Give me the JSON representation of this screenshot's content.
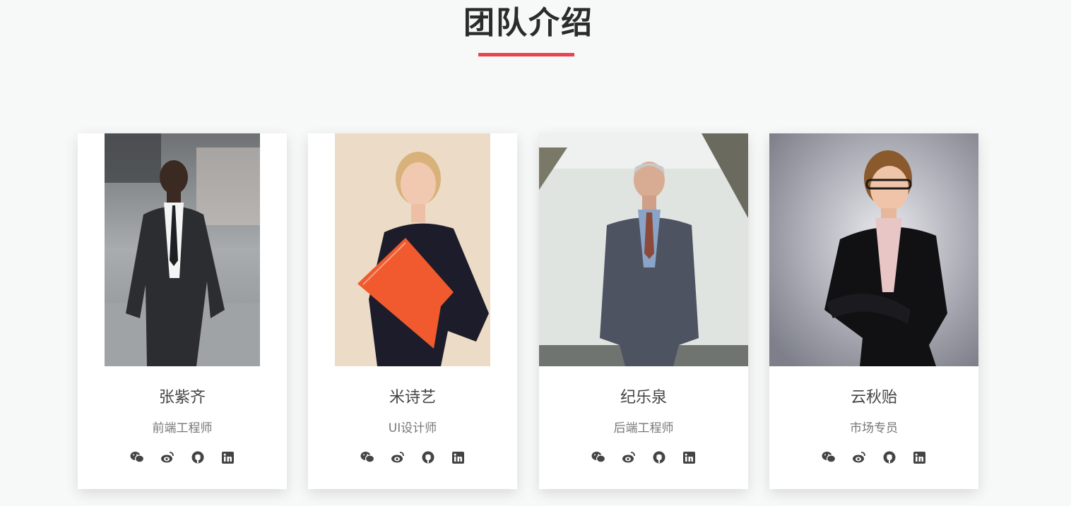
{
  "section": {
    "title": "团队介绍",
    "accent_color": "#e8434f"
  },
  "social_icons": [
    "wechat-icon",
    "weibo-icon",
    "github-icon",
    "linkedin-icon"
  ],
  "members": [
    {
      "name": "张紫齐",
      "role": "前端工程师",
      "photo": "man-dark-suit-street"
    },
    {
      "name": "米诗艺",
      "role": "UI设计师",
      "photo": "woman-orange-folder"
    },
    {
      "name": "纪乐泉",
      "role": "后端工程师",
      "photo": "older-man-gray-suit"
    },
    {
      "name": "云秋贻",
      "role": "市场专员",
      "photo": "woman-glasses-black-blazer"
    }
  ]
}
